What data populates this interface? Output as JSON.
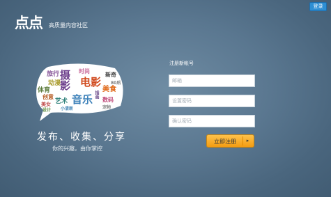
{
  "header": {
    "login_label": "登录",
    "logo_text": "点点",
    "tagline": "高质量内容社区"
  },
  "cloud": {
    "words": [
      "旅行",
      "摄影",
      "时尚",
      "新奇",
      "动漫",
      "电影",
      "美食",
      "体育",
      "音乐",
      "创意",
      "80后",
      "艺术",
      "数码",
      "美女",
      "宠物",
      "设计",
      "小清新",
      "插画"
    ]
  },
  "promo": {
    "slogan": "发布、收集、分享",
    "sub_slogan": "你的兴趣，由你掌控"
  },
  "form": {
    "title": "注册新帐号",
    "email_placeholder": "邮箱",
    "password_placeholder": "设置密码",
    "confirm_placeholder": "确认密码",
    "submit_label": "立即注册",
    "submit_arrow": "▸"
  },
  "colors": {
    "background": "#5a7790",
    "login_button": "#2e8fd4",
    "submit_button": "#f39c12"
  }
}
